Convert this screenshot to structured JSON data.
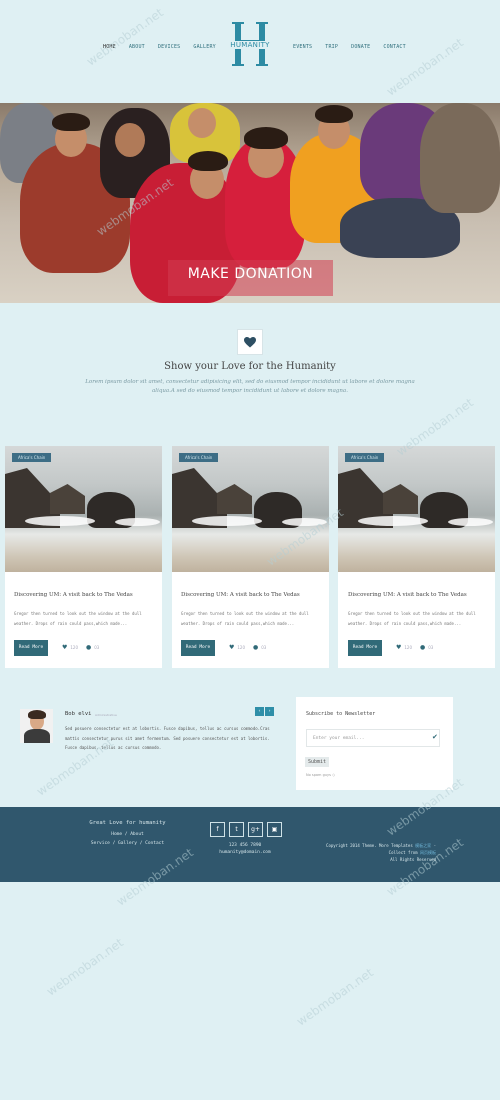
{
  "header": {
    "nav_left": [
      "HOME",
      "ABOUT",
      "DEVICES",
      "GALLERY"
    ],
    "nav_right": [
      "EVENTS",
      "TRIP",
      "DONATE",
      "CONTACT"
    ],
    "active": "HOME",
    "logo_text": "HUMANITY"
  },
  "hero": {
    "title": "MAKE DONATION"
  },
  "intro": {
    "icon": "heart-icon",
    "title": "Show your Love for the Humanity",
    "text": "Lorem ipsum dolor sit amet, consectetur adipisicing elit, sed do eiusmod tempor  incididunt ut labore et dolore magna aliqua.A sed do eiusmod tempor incididunt ut labore et dolore magna."
  },
  "cards": [
    {
      "tag": "Africa's Chain",
      "title": "Discovering UM: A visit back to The Vedas",
      "text": "Gregor then turned to look out the window at the dull weather. Drops of rain could pass,which made...",
      "button": "Read More",
      "likes": "120",
      "comments": "03"
    },
    {
      "tag": "Africa's Chain",
      "title": "Discovering UM: A visit back to The Vedas",
      "text": "Gregor then turned to look out the window at the dull weather. Drops of rain could pass,which made...",
      "button": "Read More",
      "likes": "120",
      "comments": "03"
    },
    {
      "tag": "Africa's Chain",
      "title": "Discovering UM: A visit back to The Vedas",
      "text": "Gregor then turned to look out the window at the dull weather. Drops of rain could pass,which made...",
      "button": "Read More",
      "likes": "120",
      "comments": "03"
    }
  ],
  "testimonial": {
    "name": "Bob elvi",
    "role": "Administrative",
    "text": "Sed posuere consectetur est at lobortis. Fusce dapibus, tellus ac cursus commodo.Cras mattis consectetur purus sit amet fermentum. Sed posuere consectetur est at lobortis. Fusce dapibus, tellus ac cursus commodo."
  },
  "newsletter": {
    "title": "Subscribe to Newsletter",
    "placeholder": "Enter your email...",
    "submit": "Submit",
    "note": "No spam guys :)"
  },
  "footer": {
    "title": "Great Love for humanity",
    "links1": "Home / About",
    "links2": "Service / Gallery / Contact",
    "phone": "123 456 7890",
    "email": "humanity@domain.com",
    "copyright_line1": "Copyright 2014 Theme. More Templates",
    "copyright_line1_link": "模板之家",
    "copyright_line2": "Collect from",
    "copyright_line2_link": "网页模板",
    "copyright_line3": "All Rights Reserved",
    "social": [
      {
        "icon": "facebook-icon",
        "glyph": "f"
      },
      {
        "icon": "twitter-icon",
        "glyph": "t"
      },
      {
        "icon": "google-plus-icon",
        "glyph": "g+"
      },
      {
        "icon": "instagram-icon",
        "glyph": "▣"
      }
    ]
  },
  "watermark": "webmoban.net"
}
